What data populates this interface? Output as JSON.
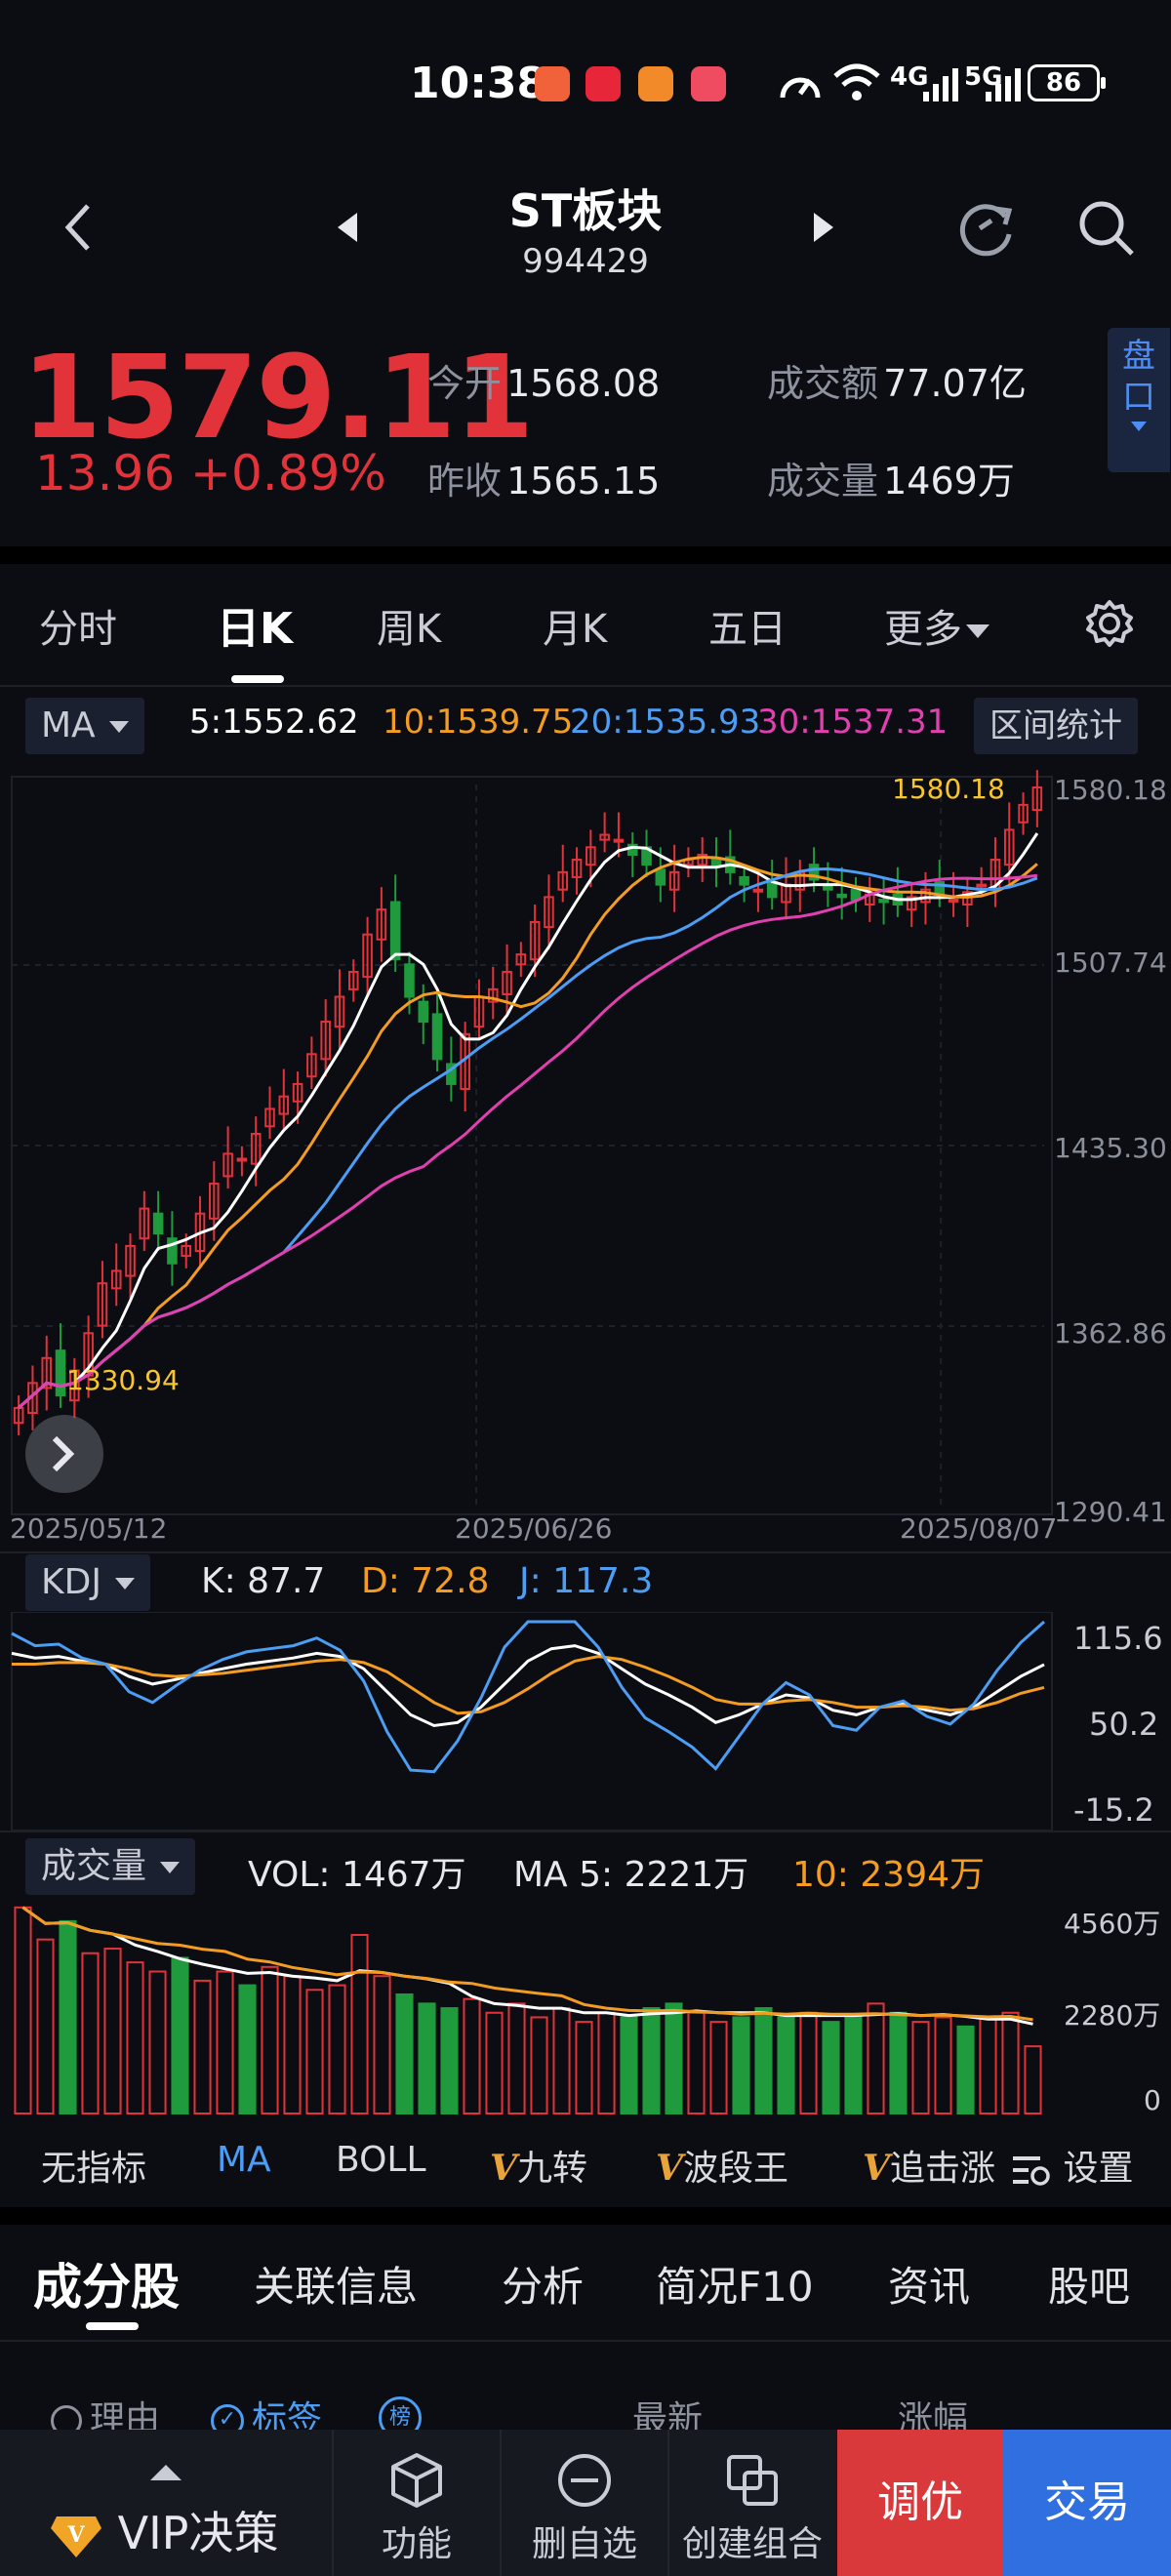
{
  "status_bar": {
    "time": "10:38",
    "network": "4G",
    "network2": "5G",
    "battery": "86"
  },
  "header": {
    "title": "ST板块",
    "code": "994429"
  },
  "quote": {
    "price": "1579.11",
    "change": "13.96",
    "change_pct": "+0.89%",
    "open_label": "今开",
    "open": "1568.08",
    "prev_label": "昨收",
    "prev": "1565.15",
    "amount_label": "成交额",
    "amount": "77.07亿",
    "volume_label": "成交量",
    "volume": "1469万",
    "pankou": "盘口"
  },
  "tabs": [
    {
      "label": "分时",
      "active": false
    },
    {
      "label": "日K",
      "active": true
    },
    {
      "label": "周K",
      "active": false
    },
    {
      "label": "月K",
      "active": false
    },
    {
      "label": "五日",
      "active": false
    },
    {
      "label": "更多",
      "active": false
    }
  ],
  "ma_row": {
    "selector": "MA",
    "ma5": "5:1552.62",
    "ma10": "10:1539.75",
    "ma20": "20:1535.93",
    "ma30": "30:1537.31",
    "range_stats": "区间统计"
  },
  "main_chart": {
    "y_ticks": [
      "1580.18",
      "1507.74",
      "1435.30",
      "1362.86",
      "1290.41"
    ],
    "x_ticks": [
      "2025/05/12",
      "2025/06/26",
      "2025/08/07"
    ],
    "high_label": "1580.18",
    "low_label": "1330.94"
  },
  "kdj": {
    "selector": "KDJ",
    "k": "K: 87.7",
    "d": "D: 72.8",
    "j": "J: 117.3",
    "y_ticks": [
      "115.6",
      "50.2",
      "-15.2"
    ]
  },
  "volume_panel": {
    "selector": "成交量",
    "vol": "VOL: 1467万",
    "ma5": "MA 5: 2221万",
    "ma10": "10: 2394万",
    "y_ticks": [
      "4560万",
      "2280万",
      "0"
    ]
  },
  "indicator_tabs": {
    "none": "无指标",
    "ma": "MA",
    "boll": "BOLL",
    "jiuzhuan": "九转",
    "boduan": "波段王",
    "zhuiji": "追击涨",
    "settings": "设置"
  },
  "sub_tabs": [
    {
      "label": "成分股",
      "active": true
    },
    {
      "label": "关联信息",
      "active": false
    },
    {
      "label": "分析",
      "active": false
    },
    {
      "label": "简况F10",
      "active": false
    },
    {
      "label": "资讯",
      "active": false
    },
    {
      "label": "股吧",
      "active": false
    }
  ],
  "list_header": {
    "reason": "理由",
    "tags": "标签",
    "rank": "榜",
    "latest": "最新",
    "change": "涨幅"
  },
  "bottom_nav": {
    "vip": "VIP决策",
    "function": "功能",
    "remove_watch": "删自选",
    "create_group": "创建组合",
    "optimize": "调优",
    "trade": "交易"
  },
  "colors": {
    "up": "#e2333b",
    "down": "#1f9a3c",
    "ma5": "#ffffff",
    "ma10": "#f39c23",
    "ma20": "#4c9ef5",
    "ma30": "#e040b0",
    "accent": "#2f6fe0"
  },
  "chart_data": [
    {
      "type": "candlestick",
      "title": "",
      "x_ticks": [
        "2025/05/12",
        "2025/06/26",
        "2025/08/07"
      ],
      "ylim": [
        1290.41,
        1580.18
      ],
      "close": [
        1330,
        1340,
        1350,
        1335,
        1345,
        1360,
        1380,
        1385,
        1395,
        1410,
        1400,
        1388,
        1395,
        1408,
        1420,
        1432,
        1430,
        1440,
        1450,
        1455,
        1460,
        1472,
        1485,
        1495,
        1505,
        1520,
        1530,
        1510,
        1495,
        1485,
        1470,
        1460,
        1480,
        1495,
        1498,
        1505,
        1512,
        1525,
        1535,
        1545,
        1550,
        1555,
        1560,
        1558,
        1552,
        1548,
        1540,
        1545,
        1550,
        1552,
        1548,
        1545,
        1540,
        1538,
        1535,
        1540,
        1545,
        1542,
        1538,
        1535,
        1534,
        1536,
        1533,
        1532,
        1535,
        1538,
        1536,
        1534,
        1537,
        1540,
        1550,
        1562,
        1572,
        1579
      ],
      "ma_series": [
        {
          "name": "MA5",
          "last": 1552.62
        },
        {
          "name": "MA10",
          "last": 1539.75
        },
        {
          "name": "MA20",
          "last": 1535.93
        },
        {
          "name": "MA30",
          "last": 1537.31
        }
      ]
    },
    {
      "type": "line",
      "title": "",
      "ylim": [
        -15.2,
        115.6
      ],
      "series": [
        {
          "name": "K",
          "values": [
            95,
            92,
            93,
            90,
            88,
            80,
            75,
            78,
            82,
            85,
            88,
            90,
            92,
            95,
            93,
            85,
            70,
            55,
            48,
            50,
            60,
            75,
            90,
            98,
            100,
            95,
            85,
            75,
            68,
            60,
            50,
            55,
            62,
            68,
            66,
            58,
            55,
            60,
            62,
            58,
            55,
            60,
            70,
            80,
            87.7
          ]
        },
        {
          "name": "D",
          "values": [
            88,
            88,
            89,
            89,
            88,
            85,
            81,
            80,
            81,
            82,
            84,
            86,
            88,
            90,
            91,
            89,
            83,
            73,
            63,
            56,
            57,
            63,
            72,
            82,
            90,
            93,
            91,
            86,
            80,
            73,
            65,
            62,
            62,
            64,
            65,
            63,
            60,
            60,
            61,
            60,
            58,
            59,
            63,
            69,
            72.8
          ]
        },
        {
          "name": "J",
          "values": [
            108,
            100,
            101,
            92,
            88,
            70,
            63,
            74,
            84,
            91,
            96,
            98,
            100,
            105,
            97,
            77,
            44,
            19,
            18,
            38,
            66,
            99,
            126,
            130,
            120,
            99,
            73,
            53,
            44,
            34,
            20,
            41,
            62,
            76,
            68,
            48,
            45,
            60,
            64,
            54,
            49,
            62,
            84,
            102,
            117.3
          ]
        }
      ]
    },
    {
      "type": "bar",
      "title": "",
      "ylim": [
        0,
        4560
      ],
      "values": [
        4500,
        3800,
        4200,
        3500,
        3600,
        3300,
        3100,
        3400,
        2900,
        3100,
        2800,
        3200,
        3000,
        2700,
        2800,
        3900,
        3000,
        2600,
        2400,
        2300,
        2500,
        2200,
        2400,
        2100,
        2300,
        2000,
        2200,
        2100,
        2300,
        2400,
        2200,
        2000,
        2100,
        2300,
        2100,
        2200,
        2000,
        2100,
        2400,
        2200,
        2000,
        2100,
        1900,
        2100,
        2200,
        1467
      ],
      "ma_series": [
        {
          "name": "MA5",
          "last": 2221
        },
        {
          "name": "MA10",
          "last": 2394
        }
      ]
    }
  ]
}
